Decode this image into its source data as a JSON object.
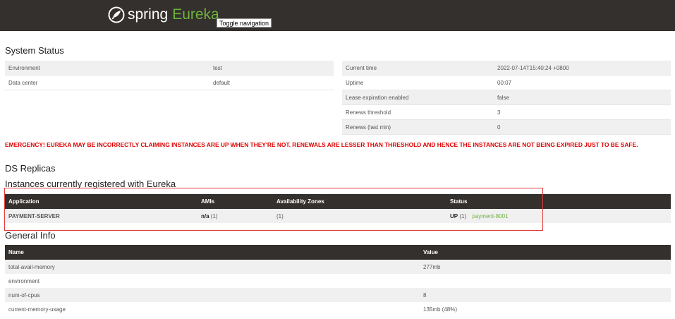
{
  "brand": {
    "spring": "spring",
    "eureka": "Eureka"
  },
  "nav": {
    "toggle_label": "Toggle navigation"
  },
  "system_status": {
    "title": "System Status",
    "left": [
      {
        "key": "Environment",
        "value": "test"
      },
      {
        "key": "Data center",
        "value": "default"
      }
    ],
    "right": [
      {
        "key": "Current time",
        "value": "2022-07-14T15:40:24 +0800"
      },
      {
        "key": "Uptime",
        "value": "00:07"
      },
      {
        "key": "Lease expiration enabled",
        "value": "false"
      },
      {
        "key": "Renews threshold",
        "value": "3"
      },
      {
        "key": "Renews (last min)",
        "value": "0"
      }
    ]
  },
  "emergency": "EMERGENCY! EUREKA MAY BE INCORRECTLY CLAIMING INSTANCES ARE UP WHEN THEY'RE NOT. RENEWALS ARE LESSER THAN THRESHOLD AND HENCE THE INSTANCES ARE NOT BEING EXPIRED JUST TO BE SAFE.",
  "ds_replicas": {
    "title": "DS Replicas"
  },
  "instances": {
    "title": "Instances currently registered with Eureka",
    "headers": [
      "Application",
      "AMIs",
      "Availability Zones",
      "Status"
    ],
    "rows": [
      {
        "application": "PAYMENT-SERVER",
        "amis_bold": "n/a",
        "amis_count": "(1)",
        "zones": "(1)",
        "status_bold": "UP",
        "status_count": "(1)",
        "status_link": "payment-8001"
      }
    ]
  },
  "general_info": {
    "title": "General Info",
    "headers": [
      "Name",
      "Value"
    ],
    "rows": [
      {
        "name": "total-avail-memory",
        "value": "277mb"
      },
      {
        "name": "environment",
        "value": ""
      },
      {
        "name": "num-of-cpus",
        "value": "8"
      },
      {
        "name": "current-memory-usage",
        "value": "135mb (48%)"
      }
    ]
  },
  "colors": {
    "navbar": "#34302d",
    "accent_green": "#6db33f",
    "emergency_red": "#e00000",
    "highlight_box": "#e23a3a"
  },
  "icons": {
    "logo": "spring-leaf-icon"
  }
}
